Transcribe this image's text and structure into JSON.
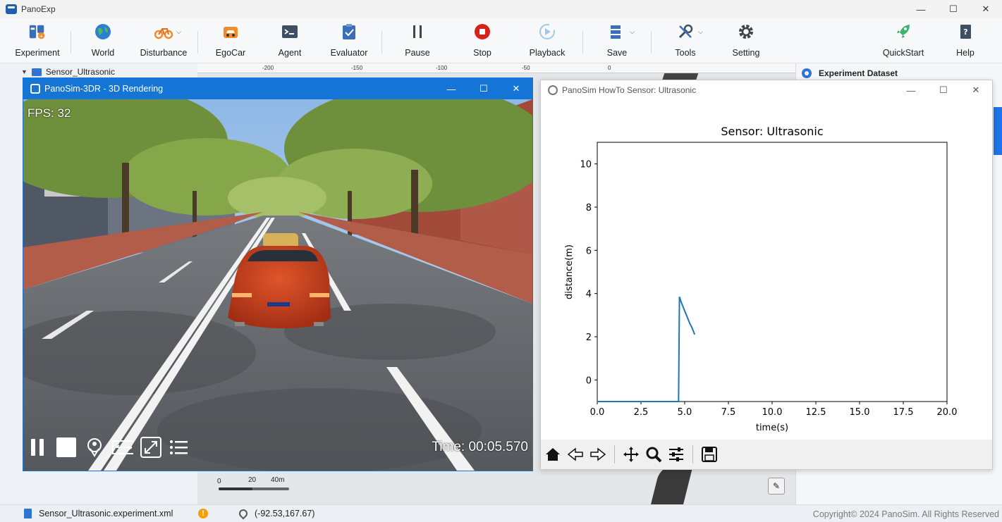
{
  "app": {
    "title": "PanoExp",
    "window_controls": {
      "minimize": "—",
      "maximize": "☐",
      "close": "✕"
    }
  },
  "toolbar": {
    "items": [
      {
        "label": "Experiment",
        "icon": "experiment-icon"
      },
      {
        "label": "World",
        "icon": "globe-icon"
      },
      {
        "label": "Disturbance",
        "icon": "bicycle-icon",
        "dropdown": true
      },
      {
        "label": "EgoCar",
        "icon": "car-icon"
      },
      {
        "label": "Agent",
        "icon": "terminal-icon"
      },
      {
        "label": "Evaluator",
        "icon": "clipboard-check-icon"
      },
      {
        "label": "Pause",
        "icon": "pause-icon"
      },
      {
        "label": "Stop",
        "icon": "stop-icon"
      },
      {
        "label": "Playback",
        "icon": "playback-icon"
      },
      {
        "label": "Save",
        "icon": "save-icon",
        "dropdown": true
      },
      {
        "label": "Tools",
        "icon": "tools-icon",
        "dropdown": true
      },
      {
        "label": "Setting",
        "icon": "gear-icon"
      },
      {
        "label": "QuickStart",
        "icon": "rocket-icon"
      },
      {
        "label": "Help",
        "icon": "help-book-icon"
      }
    ]
  },
  "tree": {
    "expanded_item": "Sensor_Ultrasonic"
  },
  "ruler": {
    "ticks": [
      "-200",
      "-150",
      "-100",
      "-50",
      "0"
    ]
  },
  "scale": {
    "labels": [
      "0",
      "20",
      "40m"
    ]
  },
  "right_panel": {
    "title": "Experiment Dataset"
  },
  "render_window": {
    "title": "PanoSim-3DR - 3D Rendering",
    "fps": "FPS: 32",
    "time": "Time: 00:05.570"
  },
  "plot_window": {
    "title": "PanoSim HowTo Sensor: Ultrasonic",
    "toolbar_icons": [
      "home-icon",
      "back-arrow-icon",
      "forward-arrow-icon",
      "pan-icon",
      "zoom-icon",
      "configure-icon",
      "save-figure-icon"
    ]
  },
  "chart_data": {
    "type": "line",
    "title": "Sensor: Ultrasonic",
    "xlabel": "time(s)",
    "ylabel": "distance(m)",
    "xlim": [
      0,
      20
    ],
    "ylim": [
      -1,
      11
    ],
    "xticks": [
      "0.0",
      "2.5",
      "5.0",
      "7.5",
      "10.0",
      "12.5",
      "15.0",
      "17.5",
      "20.0"
    ],
    "yticks": [
      "0",
      "2",
      "4",
      "6",
      "8",
      "10"
    ],
    "line_color": "#1f77b4",
    "x": [
      0.0,
      1.0,
      2.0,
      3.0,
      4.0,
      4.65,
      4.7,
      4.8,
      4.9,
      5.0,
      5.1,
      5.2,
      5.3,
      5.4,
      5.5,
      5.57
    ],
    "y": [
      -1.0,
      -1.0,
      -1.0,
      -1.0,
      -1.0,
      -1.0,
      3.85,
      3.6,
      3.4,
      3.2,
      3.0,
      2.8,
      2.6,
      2.45,
      2.25,
      2.1
    ]
  },
  "statusbar": {
    "file": "Sensor_Ultrasonic.experiment.xml",
    "warning": "!",
    "coords": "(-92.53,167.67)",
    "copyright": "Copyright© 2024 PanoSim. All Rights Reserved"
  },
  "colors": {
    "accent": "#1475d6",
    "stop": "#d9201b",
    "quickstart": "#3cb46e"
  }
}
